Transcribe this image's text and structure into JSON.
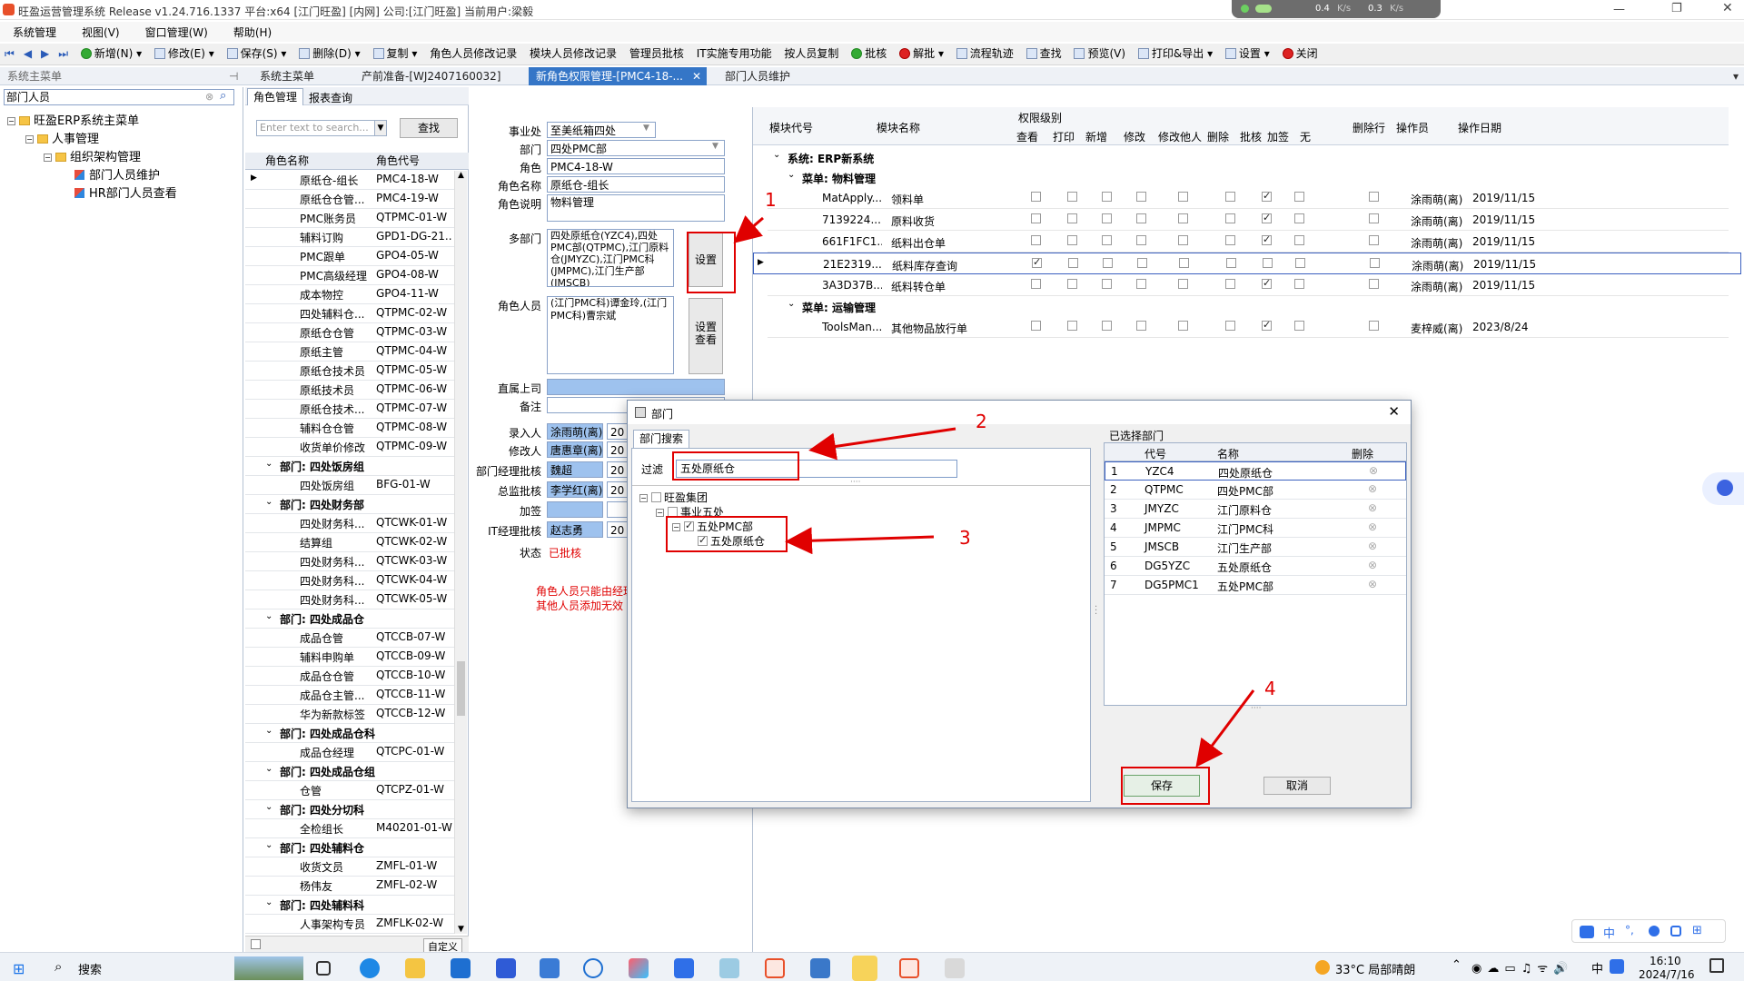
{
  "window": {
    "title": "旺盈运营管理系统 Release v1.24.716.1337 平台:x64  [江门旺盈] [内网] 公司:[江门旺盈] 当前用户:梁毅",
    "net_status": {
      "up": "0.4",
      "down": "0.3",
      "unit": "K/s"
    }
  },
  "menubar": [
    "系统管理",
    "视图(V)",
    "窗口管理(W)",
    "帮助(H)"
  ],
  "toolbar": {
    "buttons": [
      "新增(N)",
      "修改(E)",
      "保存(S)",
      "删除(D)",
      "复制",
      "角色人员修改记录",
      "模块人员修改记录",
      "管理员批核",
      "IT实施专用功能",
      "按人员复制",
      "批核",
      "解批",
      "流程轨迹",
      "查找",
      "预览(V)",
      "打印&导出",
      "设置",
      "关闭"
    ]
  },
  "doc_tabs": {
    "panel_title": "系统主菜单",
    "tabs": [
      "系统主菜单",
      "产前准备-[WJ2407160032]",
      "新角色权限管理-[PMC4-18-...",
      "部门人员维护"
    ],
    "active_index": 2
  },
  "left_tree": {
    "search_value": "部门人员",
    "root": "旺盈ERP系统主菜单",
    "level1": "人事管理",
    "level2": "组织架构管理",
    "leaves": [
      "部门人员维护",
      "HR部门人员查看"
    ]
  },
  "inner_tabs": [
    "角色管理",
    "报表查询"
  ],
  "role_grid": {
    "search_placeholder": "Enter text to search...",
    "search_button": "查找",
    "col_name": "角色名称",
    "col_code": "角色代号",
    "rows": [
      {
        "type": "row",
        "name": "原纸仓-组长",
        "code": "PMC4-18-W"
      },
      {
        "type": "row",
        "name": "原纸仓仓管...",
        "code": "PMC4-19-W"
      },
      {
        "type": "row",
        "name": "PMC账务员",
        "code": "QTPMC-01-W"
      },
      {
        "type": "row",
        "name": "辅料订购",
        "code": "GPD1-DG-21..."
      },
      {
        "type": "row",
        "name": "PMC跟单",
        "code": "GPO4-05-W"
      },
      {
        "type": "row",
        "name": "PMC高级经理",
        "code": "GPO4-08-W"
      },
      {
        "type": "row",
        "name": "成本物控",
        "code": "GPO4-11-W"
      },
      {
        "type": "row",
        "name": "四处辅料仓...",
        "code": "QTPMC-02-W"
      },
      {
        "type": "row",
        "name": "原纸仓仓管",
        "code": "QTPMC-03-W"
      },
      {
        "type": "row",
        "name": "原纸主管",
        "code": "QTPMC-04-W"
      },
      {
        "type": "row",
        "name": "原纸仓技术员",
        "code": "QTPMC-05-W"
      },
      {
        "type": "row",
        "name": "原纸技术员",
        "code": "QTPMC-06-W"
      },
      {
        "type": "row",
        "name": "原纸仓技术...",
        "code": "QTPMC-07-W"
      },
      {
        "type": "row",
        "name": "辅料仓仓管",
        "code": "QTPMC-08-W"
      },
      {
        "type": "row",
        "name": "收货单价修改",
        "code": "QTPMC-09-W"
      },
      {
        "type": "group",
        "name": "部门: 四处饭房组"
      },
      {
        "type": "row",
        "name": "四处饭房组",
        "code": "BFG-01-W"
      },
      {
        "type": "group",
        "name": "部门: 四处财务部"
      },
      {
        "type": "row",
        "name": "四处财务科...",
        "code": "QTCWK-01-W"
      },
      {
        "type": "row",
        "name": "结算组",
        "code": "QTCWK-02-W"
      },
      {
        "type": "row",
        "name": "四处财务科...",
        "code": "QTCWK-03-W"
      },
      {
        "type": "row",
        "name": "四处财务科...",
        "code": "QTCWK-04-W"
      },
      {
        "type": "row",
        "name": "四处财务科...",
        "code": "QTCWK-05-W"
      },
      {
        "type": "group",
        "name": "部门: 四处成品仓"
      },
      {
        "type": "row",
        "name": "成品仓管",
        "code": "QTCCB-07-W"
      },
      {
        "type": "row",
        "name": "辅料申购单",
        "code": "QTCCB-09-W"
      },
      {
        "type": "row",
        "name": "成品仓仓管",
        "code": "QTCCB-10-W"
      },
      {
        "type": "row",
        "name": "成品仓主管...",
        "code": "QTCCB-11-W"
      },
      {
        "type": "row",
        "name": "华为新款标签",
        "code": "QTCCB-12-W"
      },
      {
        "type": "group",
        "name": "部门: 四处成品仓科"
      },
      {
        "type": "row",
        "name": "成品仓经理",
        "code": "QTCPC-01-W"
      },
      {
        "type": "group",
        "name": "部门: 四处成品仓组"
      },
      {
        "type": "row",
        "name": "仓管",
        "code": "QTCPZ-01-W"
      },
      {
        "type": "group",
        "name": "部门: 四处分切科"
      },
      {
        "type": "row",
        "name": "全检组长",
        "code": "M40201-01-W"
      },
      {
        "type": "group",
        "name": "部门: 四处辅料仓"
      },
      {
        "type": "row",
        "name": "收货文员",
        "code": "ZMFL-01-W"
      },
      {
        "type": "row",
        "name": "杨伟友",
        "code": "ZMFL-02-W"
      },
      {
        "type": "group",
        "name": "部门: 四处辅料科"
      },
      {
        "type": "row",
        "name": "人事架构专员",
        "code": "ZMFLK-02-W"
      }
    ],
    "footer_label": "自定义"
  },
  "role_form": {
    "labels": [
      "事业处",
      "部门",
      "角色",
      "角色名称",
      "角色说明",
      "多部门",
      "角色人员",
      "直属上司",
      "备注",
      "录入人",
      "修改人",
      "部门经理批核",
      "总监批核",
      "加签",
      "IT经理批核",
      "状态"
    ],
    "business_unit": "至美纸箱四处",
    "department": "四处PMC部",
    "role": "PMC4-18-W",
    "role_name": "原纸仓-组长",
    "role_desc": "物料管理",
    "multi_dept": "四处原纸仓(YZC4),四处PMC部(QTPMC),江门原料仓(JMYZC),江门PMC科(JMPMC),江门生产部(JMSCB)",
    "role_members": "(江门PMC科)谭金玲,(江门PMC科)曹宗斌",
    "entry_by": "涂雨萌(离)",
    "modified_by": "唐惠章(离)",
    "dept_mgr": "魏超",
    "director": "李学红(离)",
    "it_mgr": "赵志勇",
    "date_prefix": "20",
    "status": "已批核",
    "set_button": "设置",
    "view_button": "设置\n查看",
    "hint1": "角色人员只能由经理",
    "hint2": "其他人员添加无效"
  },
  "permission_grid": {
    "headers": {
      "module_code": "模块代号",
      "module_name": "模块名称",
      "level": "权限级别",
      "delete_row": "删除行",
      "operator": "操作员",
      "op_date": "操作日期"
    },
    "perm_cols": [
      "查看",
      "打印",
      "新增",
      "修改",
      "修改他人",
      "删除",
      "批核",
      "加签",
      "无"
    ],
    "system_label": "系统: ERP新系统",
    "menus": [
      {
        "label": "菜单: 物料管理",
        "rows": [
          {
            "code": "MatApply...",
            "name": "领料单",
            "checks": [
              0,
              0,
              0,
              0,
              0,
              0,
              1,
              0,
              0
            ],
            "operator": "涂雨萌(离)",
            "date": "2019/11/15"
          },
          {
            "code": "7139224...",
            "name": "原料收货",
            "checks": [
              0,
              0,
              0,
              0,
              0,
              0,
              1,
              0,
              0
            ],
            "operator": "涂雨萌(离)",
            "date": "2019/11/15"
          },
          {
            "code": "661F1FC1...",
            "name": "纸料出仓单",
            "checks": [
              0,
              0,
              0,
              0,
              0,
              0,
              1,
              0,
              0
            ],
            "operator": "涂雨萌(离)",
            "date": "2019/11/15"
          },
          {
            "code": "21E2319...",
            "name": "纸料库存查询",
            "checks": [
              1,
              0,
              0,
              0,
              0,
              0,
              0,
              0,
              0
            ],
            "operator": "涂雨萌(离)",
            "date": "2019/11/15",
            "selected": true
          },
          {
            "code": "3A3D37B...",
            "name": "纸料转仓单",
            "checks": [
              0,
              0,
              0,
              0,
              0,
              0,
              1,
              0,
              0
            ],
            "operator": "涂雨萌(离)",
            "date": "2019/11/15"
          }
        ]
      },
      {
        "label": "菜单: 运输管理",
        "rows": [
          {
            "code": "ToolsMan...",
            "name": "其他物品放行单",
            "checks": [
              0,
              0,
              0,
              0,
              0,
              0,
              1,
              0,
              0
            ],
            "operator": "麦梓威(离)",
            "date": "2023/8/24"
          }
        ]
      }
    ]
  },
  "dialog": {
    "title": "部门",
    "tab": "部门搜索",
    "filter_label": "过滤",
    "filter_value": "五处原纸仓",
    "tree": [
      "旺盈集团",
      "事业五处",
      "五处PMC部",
      "五处原纸仓"
    ],
    "selected_title": "已选择部门",
    "columns": [
      "代号",
      "名称",
      "删除"
    ],
    "rows": [
      {
        "no": "1",
        "code": "YZC4",
        "name": "四处原纸仓"
      },
      {
        "no": "2",
        "code": "QTPMC",
        "name": "四处PMC部"
      },
      {
        "no": "3",
        "code": "JMYZC",
        "name": "江门原料仓"
      },
      {
        "no": "4",
        "code": "JMPMC",
        "name": "江门PMC科"
      },
      {
        "no": "5",
        "code": "JMSCB",
        "name": "江门生产部"
      },
      {
        "no": "6",
        "code": "DG5YZC",
        "name": "五处原纸仓"
      },
      {
        "no": "7",
        "code": "DG5PMC1",
        "name": "五处PMC部"
      }
    ],
    "save": "保存",
    "cancel": "取消"
  },
  "annotations": [
    "1",
    "2",
    "3",
    "4"
  ],
  "taskbar": {
    "search": "搜索",
    "weather": "33°C  局部晴朗",
    "time": "16:10",
    "date": "2024/7/16",
    "ime": "中"
  }
}
